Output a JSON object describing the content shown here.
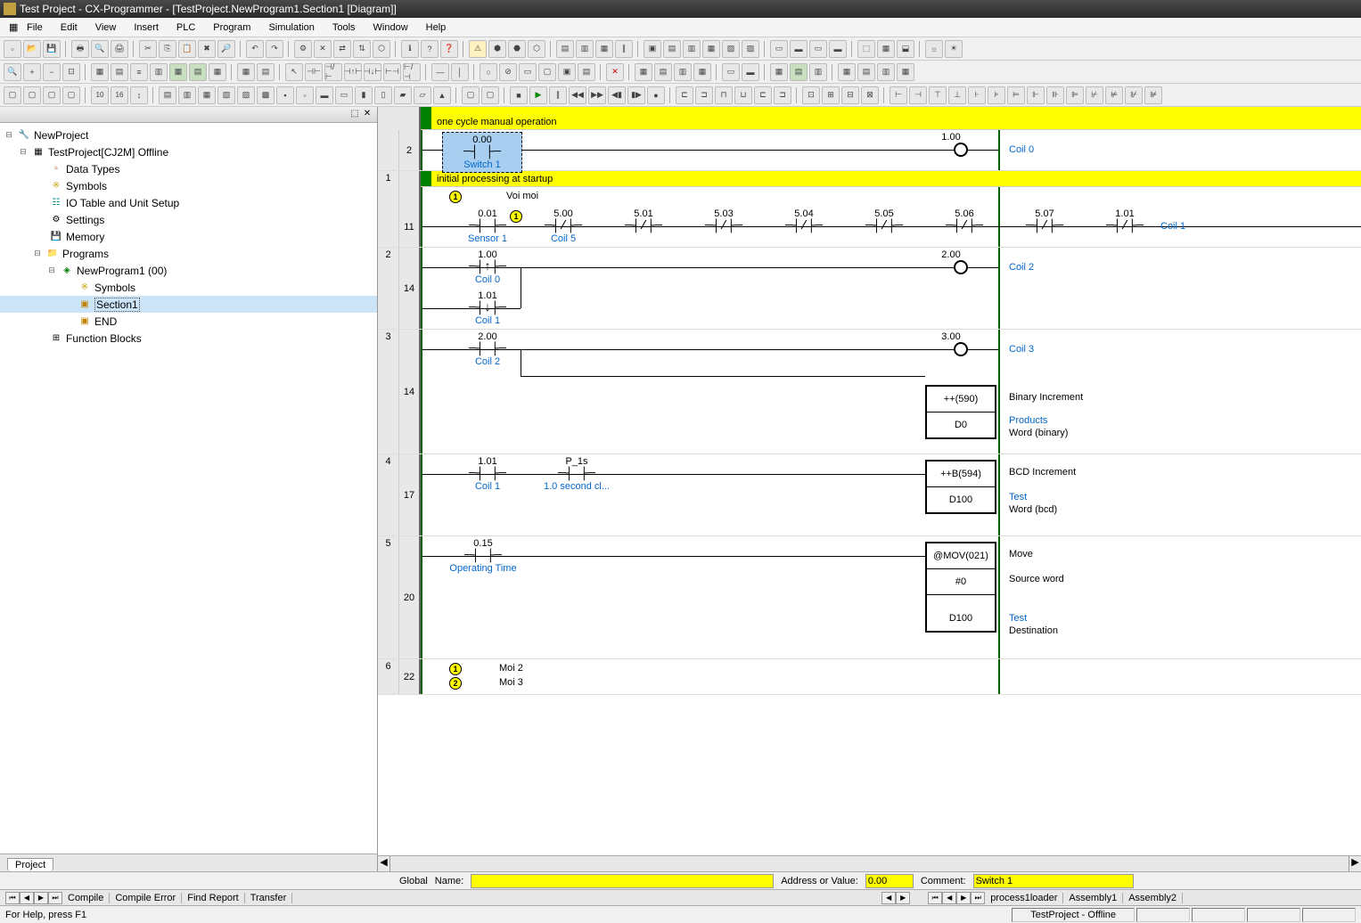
{
  "title": "Test Project - CX-Programmer - [TestProject.NewProgram1.Section1 [Diagram]]",
  "menu": [
    "File",
    "Edit",
    "View",
    "Insert",
    "PLC",
    "Program",
    "Simulation",
    "Tools",
    "Window",
    "Help"
  ],
  "tree": {
    "root": "NewProject",
    "plc": "TestProject[CJ2M] Offline",
    "items": [
      "Data Types",
      "Symbols",
      "IO Table and Unit Setup",
      "Settings",
      "Memory",
      "Programs"
    ],
    "program": "NewProgram1 (00)",
    "prog_items": [
      "Symbols",
      "Section1",
      "END"
    ],
    "fb": "Function Blocks"
  },
  "sidebar_tab": "Project",
  "comments": {
    "c1": "one cycle manual operation",
    "c2": "initial processing at startup",
    "voi": "Voi moi",
    "moi2": "Moi 2",
    "moi3": "Moi 3"
  },
  "rungs": {
    "r1": {
      "step": "2",
      "contact": {
        "addr": "0.00",
        "name": "Switch 1"
      },
      "coil": {
        "addr": "1.00",
        "name": "Coil 0"
      }
    },
    "r2": {
      "step": "11",
      "contacts": [
        {
          "addr": "0.01",
          "name": "Sensor 1"
        },
        {
          "addr": "5.00",
          "name": "Coil 5"
        },
        {
          "addr": "5.01"
        },
        {
          "addr": "5.03"
        },
        {
          "addr": "5.04"
        },
        {
          "addr": "5.05"
        },
        {
          "addr": "5.06"
        },
        {
          "addr": "5.07"
        },
        {
          "addr": "1.01"
        }
      ],
      "coil_name": "Coil 1"
    },
    "r3": {
      "num": "2",
      "step": "14",
      "c1": {
        "addr": "1.00",
        "name": "Coil 0"
      },
      "c2": {
        "addr": "1.01",
        "name": "Coil 1"
      },
      "coil": {
        "addr": "2.00",
        "name": "Coil 2"
      }
    },
    "r4": {
      "num": "3",
      "step": "14",
      "c": {
        "addr": "2.00",
        "name": "Coil 2"
      },
      "coil": {
        "addr": "3.00",
        "name": "Coil 3"
      },
      "box1": {
        "op": "++(590)",
        "operand": "D0",
        "label": "Binary Increment",
        "sym": "Products",
        "type": "Word (binary)"
      }
    },
    "r5": {
      "num": "4",
      "step": "17",
      "c1": {
        "addr": "1.01",
        "name": "Coil 1"
      },
      "c2": {
        "addr": "P_1s",
        "name": "1.0 second cl..."
      },
      "box": {
        "op": "++B(594)",
        "operand": "D100",
        "label": "BCD Increment",
        "sym": "Test",
        "type": "Word (bcd)"
      }
    },
    "r6": {
      "num": "5",
      "step": "20",
      "c": {
        "addr": "0.15",
        "name": "Operating Time"
      },
      "box": {
        "op": "@MOV(021)",
        "op1": "#0",
        "op2": "D100",
        "label": "Move",
        "l1": "Source word",
        "sym": "Test",
        "l2": "Destination"
      }
    },
    "r7": {
      "num": "6",
      "step": "22"
    }
  },
  "infobar": {
    "global": "Global",
    "name_l": "Name:",
    "name_v": "",
    "addr_l": "Address or Value:",
    "addr_v": "0.00",
    "comment_l": "Comment:",
    "comment_v": "Switch 1"
  },
  "bottom_tabs_left": [
    "Compile",
    "Compile Error",
    "Find Report",
    "Transfer"
  ],
  "bottom_tabs_right": [
    "process1loader",
    "Assembly1",
    "Assembly2"
  ],
  "status": {
    "help": "For Help, press F1",
    "plc": "TestProject - Offline"
  }
}
